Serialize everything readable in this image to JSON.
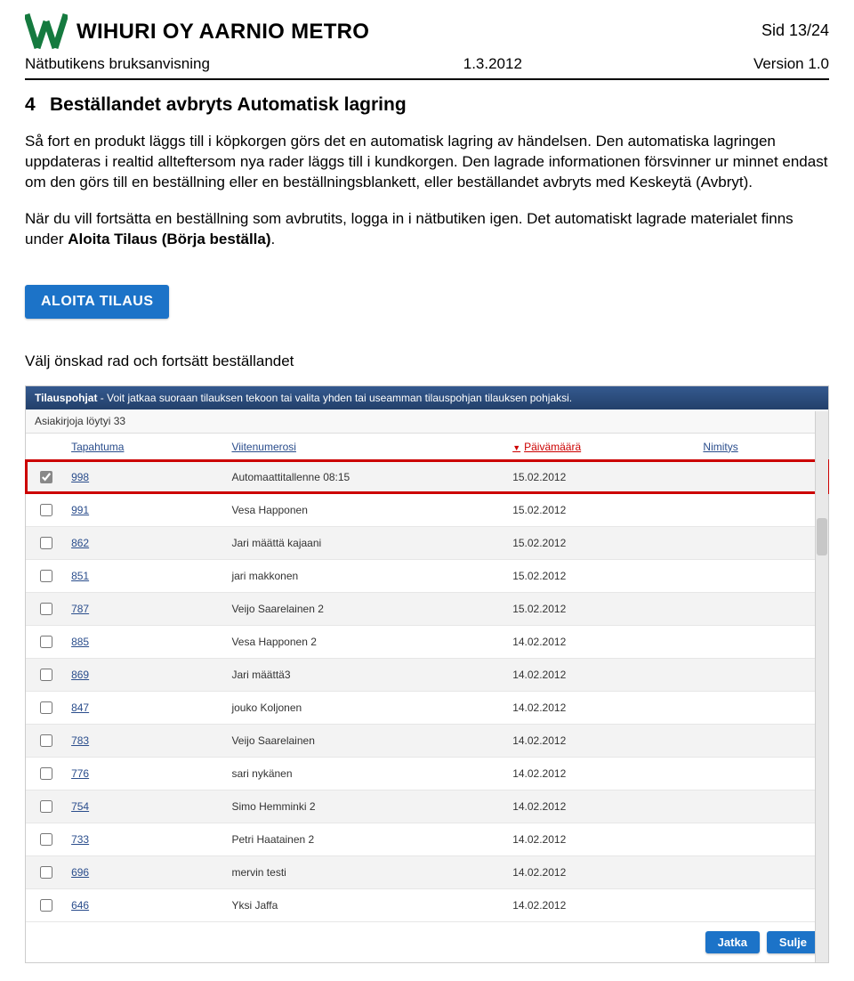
{
  "header": {
    "company_line": "WIHURI OY AARNIO METRO",
    "page_label": "Sid 13/24",
    "doc_title": "Nätbutikens bruksanvisning",
    "date": "1.3.2012",
    "version": "Version 1.0"
  },
  "section": {
    "number": "4",
    "title": "Beställandet avbryts Automatisk lagring"
  },
  "paragraphs": {
    "p1_a": "Så fort en produkt läggs till i köpkorgen görs det en automatisk lagring av händelsen. Den automatiska lagringen uppdateras i realtid allteftersom nya rader läggs till i kundkorgen. Den lagrade informationen försvinner ur minnet endast om den görs till en beställning eller en beställningsblankett, eller beställandet avbryts med Keskeytä (Avbryt).",
    "p2_a": "När du vill fortsätta en beställning som avbrutits, logga in i nätbutiken igen. Det automatiskt lagrade materialet finns under ",
    "p2_strong": "Aloita Tilaus (Börja beställa)",
    "p2_b": "."
  },
  "buttons": {
    "aloita": "ALOITA TILAUS"
  },
  "subheading": "Välj önskad rad och fortsätt beställandet",
  "shot": {
    "header_prefix": "Tilauspohjat",
    "header_divider": " - ",
    "header_text": "Voit jatkaa suoraan tilauksen tekoon tai valita yhden tai useamman tilauspohjan tilauksen pohjaksi.",
    "result_count": "Asiakirjoja löytyi 33",
    "columns": {
      "tapahtuma": "Tapahtuma",
      "viite": "Viitenumerosi",
      "paivamaara": "Päivämäärä",
      "nimitys": "Nimitys"
    },
    "rows": [
      {
        "checked": true,
        "tapahtuma": "998",
        "viite": "Automaattitallenne 08:15",
        "date": "15.02.2012",
        "selected": true
      },
      {
        "checked": false,
        "tapahtuma": "991",
        "viite": "Vesa Happonen",
        "date": "15.02.2012"
      },
      {
        "checked": false,
        "tapahtuma": "862",
        "viite": "Jari määttä kajaani",
        "date": "15.02.2012"
      },
      {
        "checked": false,
        "tapahtuma": "851",
        "viite": "jari makkonen",
        "date": "15.02.2012"
      },
      {
        "checked": false,
        "tapahtuma": "787",
        "viite": "Veijo Saarelainen 2",
        "date": "15.02.2012"
      },
      {
        "checked": false,
        "tapahtuma": "885",
        "viite": "Vesa Happonen 2",
        "date": "14.02.2012"
      },
      {
        "checked": false,
        "tapahtuma": "869",
        "viite": "Jari määttä3",
        "date": "14.02.2012"
      },
      {
        "checked": false,
        "tapahtuma": "847",
        "viite": "jouko Koljonen",
        "date": "14.02.2012"
      },
      {
        "checked": false,
        "tapahtuma": "783",
        "viite": "Veijo Saarelainen",
        "date": "14.02.2012"
      },
      {
        "checked": false,
        "tapahtuma": "776",
        "viite": "sari nykänen",
        "date": "14.02.2012"
      },
      {
        "checked": false,
        "tapahtuma": "754",
        "viite": "Simo Hemminki 2",
        "date": "14.02.2012"
      },
      {
        "checked": false,
        "tapahtuma": "733",
        "viite": "Petri Haatainen 2",
        "date": "14.02.2012"
      },
      {
        "checked": false,
        "tapahtuma": "696",
        "viite": "mervin testi",
        "date": "14.02.2012"
      },
      {
        "checked": false,
        "tapahtuma": "646",
        "viite": "Yksi Jaffa",
        "date": "14.02.2012"
      }
    ],
    "footer": {
      "jatka": "Jatka",
      "sulje": "Sulje"
    }
  }
}
